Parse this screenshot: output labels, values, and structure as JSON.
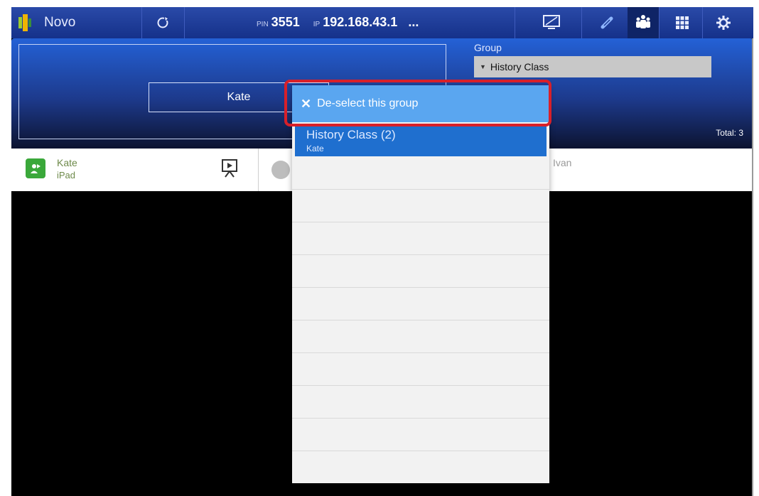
{
  "topbar": {
    "app_name": "Novo",
    "pin_label": "PIN",
    "pin_value": "3551",
    "ip_label": "IP",
    "ip_value": "192.168.43.1",
    "ip_more": "...",
    "icons": [
      "refresh-icon",
      "screen-icon",
      "link-icon",
      "group-icon",
      "grid-icon",
      "settings-icon"
    ]
  },
  "panel": {
    "presenter_name": "Kate",
    "group_label": "Group",
    "group_selected": "History Class",
    "total": "Total: 3"
  },
  "devices": [
    {
      "name": "Kate",
      "type": "iPad"
    },
    {
      "name": "Ivan",
      "type": ""
    }
  ],
  "devices_display": {
    "ivan_label": "Ivan"
  },
  "dropdown": {
    "deselect_label": "De-select this group",
    "selected_item": {
      "title": "History Class (2)",
      "members": "Kate"
    },
    "empty_rows": 9
  },
  "colors": {
    "topbar": "#15318a",
    "deselect_bg": "#5aa6f0",
    "selected_bg": "#1f6fcf",
    "highlight_border": "#d8202a"
  }
}
